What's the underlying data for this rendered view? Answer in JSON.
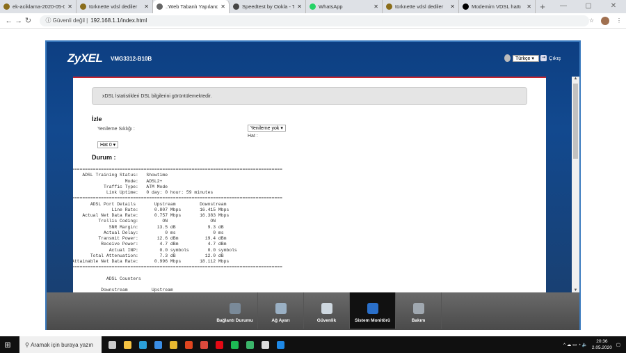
{
  "browser": {
    "tabs": [
      {
        "label": "ek-aciklama-2020-05-0",
        "icon_color": "#8a6d1a",
        "active": false
      },
      {
        "label": "türknette vdsl dediler",
        "icon_color": "#8a6d1a",
        "active": false
      },
      {
        "label": ".:Web Tabanlı Yapıland",
        "icon_color": "#666",
        "active": true
      },
      {
        "label": "Speedtest by Ookla - T",
        "icon_color": "#444",
        "active": false
      },
      {
        "label": "WhatsApp",
        "icon_color": "#25d366",
        "active": false
      },
      {
        "label": "türknette vdsl dediler",
        "icon_color": "#8a6d1a",
        "active": false
      },
      {
        "label": "Modemim VDSL hattı",
        "icon_color": "#000",
        "active": false
      }
    ],
    "new_tab": "+",
    "security": "Güvenli değil",
    "url": "192.168.1.1/index.html"
  },
  "header": {
    "logo": "ZyXEL",
    "model": "VMG3312-B10B",
    "language": "Türkçe",
    "logout": "Çıkış"
  },
  "info_text": "xDSL İstatistikleri DSL bilgilerini görüntülemektedir.",
  "monitor": {
    "title": "İzle",
    "refresh_label": "Yenileme Sıklığı :",
    "refresh_value": "Yenileme yok",
    "line_label": "Hat :",
    "line_value": "Hat 0"
  },
  "status": {
    "title": "Durum :",
    "text": "===============================================================================\n    ADSL Training Status:   Showtime\n                    Mode:   ADSL2+\n            Traffic Type:   ATM Mode\n             Link Uptime:   0 day: 0 hour: 59 minutes\n===============================================================================\n       ADSL Port Details       Upstream         Downstream\n               Line Rate:      0.807 Mbps       16.415 Mbps\n    Actual Net Data Rate:      0.757 Mbps       16.383 Mbps\n          Trellis Coding:         ON                ON\n              SNR Margin:       13.5 dB            9.3 dB\n            Actual Delay:          0 ms              0 ms\n          Transmit Power:       12.6 dBm          19.4 dBm\n           Receive Power:        4.7 dBm           4.7 dBm\n              Actual INP:        0.0 symbols       0.0 symbols\n       Total Attenuation:        7.3 dB           12.0 dB\nAttainable Net Data Rate:      0.996 Mbps       18.112 Mbps\n===============================================================================\n\n             ADSL Counters\n\n           Downstream         Upstream"
  },
  "nav": [
    {
      "label": "Bağlantı Durumu",
      "icon": "connection-status-icon",
      "color": "#7a8a99",
      "active": false
    },
    {
      "label": "Ağ Ayarı",
      "icon": "gear-icon",
      "color": "#9ab0c4",
      "active": false
    },
    {
      "label": "Güvenlik",
      "icon": "shield-icon",
      "color": "#cfd8e0",
      "active": false
    },
    {
      "label": "Sistem Monitörü",
      "icon": "chart-monitor-icon",
      "color": "#2a6fc9",
      "active": true
    },
    {
      "label": "Bakım",
      "icon": "maintenance-icon",
      "color": "#a0a8b0",
      "active": false
    }
  ],
  "taskbar": {
    "search_placeholder": "Aramak için buraya yazın",
    "time": "20:36",
    "date": "2.05.2020",
    "apps": [
      {
        "name": "task-view",
        "color": "#ccc"
      },
      {
        "name": "store",
        "color": "#f5c342"
      },
      {
        "name": "edge",
        "color": "#2b9fd8"
      },
      {
        "name": "mail",
        "color": "#3a8ee6"
      },
      {
        "name": "explorer",
        "color": "#e8b830"
      },
      {
        "name": "office",
        "color": "#e0451f"
      },
      {
        "name": "chrome",
        "color": "#dc4a3c"
      },
      {
        "name": "netflix",
        "color": "#e50914"
      },
      {
        "name": "spotify",
        "color": "#1db954"
      },
      {
        "name": "app-green",
        "color": "#3bb56a"
      },
      {
        "name": "settings",
        "color": "#ddd"
      },
      {
        "name": "photos",
        "color": "#1e88e5"
      }
    ]
  }
}
